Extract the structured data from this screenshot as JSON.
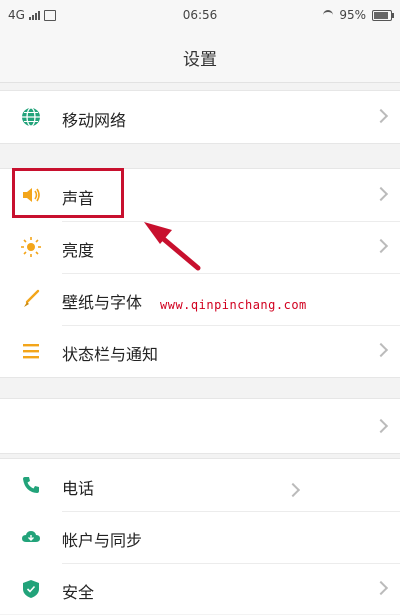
{
  "status_bar": {
    "network": "4G",
    "time": "06:56",
    "battery": "95%"
  },
  "header": {
    "title": "设置"
  },
  "settings": {
    "mobile_network": "移动网络",
    "sound": "声音",
    "brightness": "亮度",
    "wallpaper_fonts": "壁纸与字体",
    "statusbar_notifications": "状态栏与通知",
    "phone": "电话",
    "accounts_sync": "帐户与同步",
    "security": "安全"
  },
  "watermark": "www.qinpinchang.com",
  "colors": {
    "accent_green": "#22a37a",
    "sound_orange": "#f3a51a",
    "annotation_red": "#c8102e"
  }
}
